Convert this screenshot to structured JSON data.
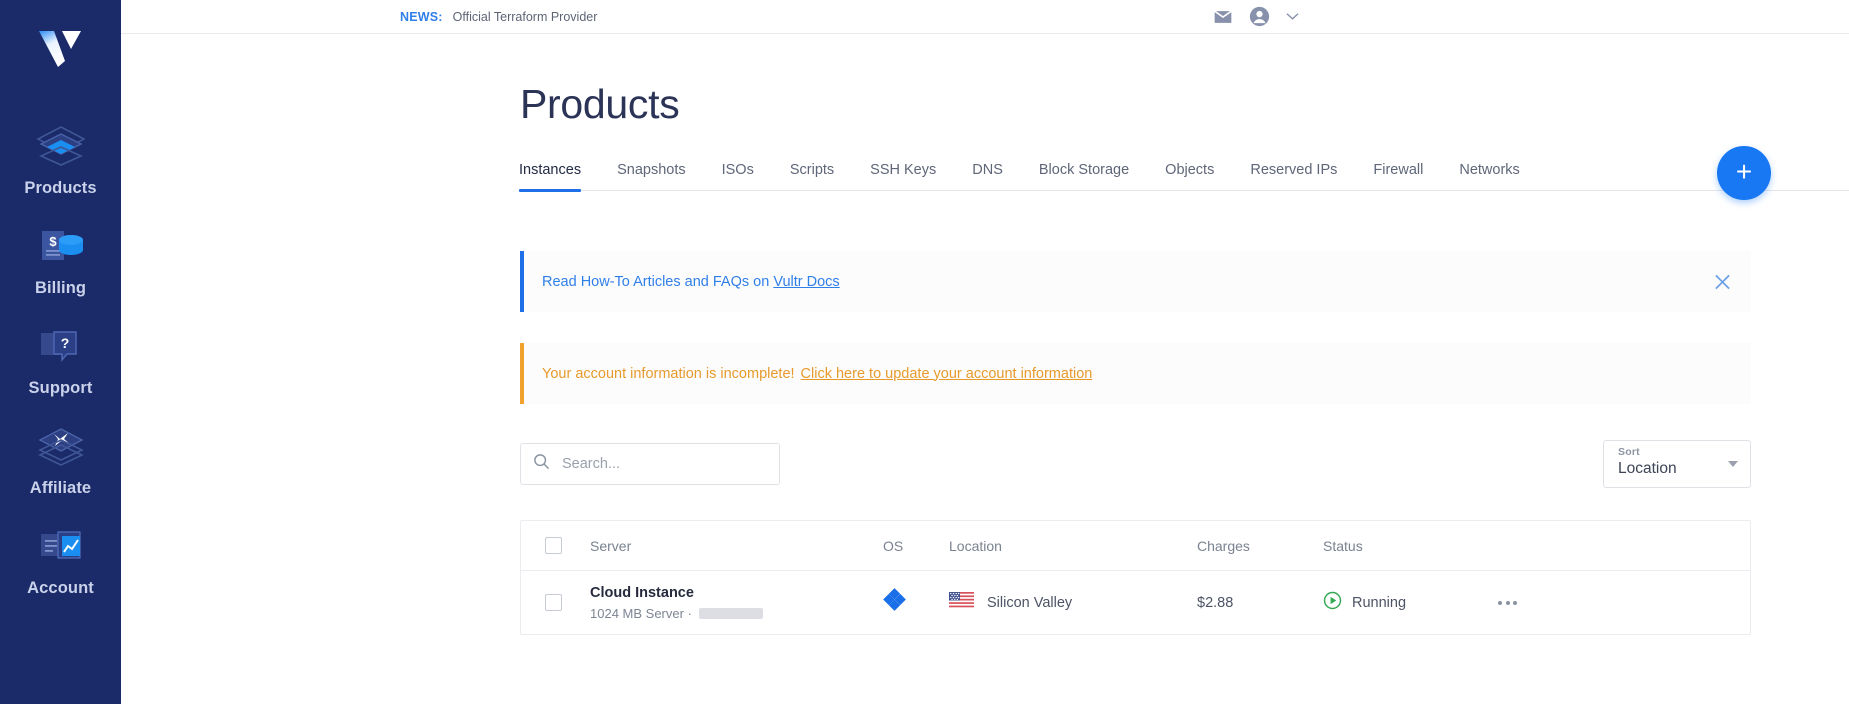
{
  "sidebar": {
    "logo": "vultr-logo",
    "items": [
      {
        "label": "Products",
        "icon": "layers-icon"
      },
      {
        "label": "Billing",
        "icon": "billing-dollar-coins-icon"
      },
      {
        "label": "Support",
        "icon": "support-question-icon"
      },
      {
        "label": "Affiliate",
        "icon": "affiliate-x-layers-icon"
      },
      {
        "label": "Account",
        "icon": "account-chart-icon"
      }
    ]
  },
  "topbar": {
    "news_tag": "NEWS:",
    "news_text": "Official Terraform Provider",
    "mail_icon": "mail-icon",
    "account_icon": "account-circle-icon",
    "chevron_icon": "chevron-down-icon"
  },
  "page": {
    "title": "Products"
  },
  "tabs": [
    {
      "label": "Instances",
      "active": true
    },
    {
      "label": "Snapshots",
      "active": false
    },
    {
      "label": "ISOs",
      "active": false
    },
    {
      "label": "Scripts",
      "active": false
    },
    {
      "label": "SSH Keys",
      "active": false
    },
    {
      "label": "DNS",
      "active": false
    },
    {
      "label": "Block Storage",
      "active": false
    },
    {
      "label": "Objects",
      "active": false
    },
    {
      "label": "Reserved IPs",
      "active": false
    },
    {
      "label": "Firewall",
      "active": false
    },
    {
      "label": "Networks",
      "active": false
    }
  ],
  "fab": {
    "label": "+",
    "icon": "plus-icon",
    "color": "#1877f2"
  },
  "banners": {
    "info": {
      "text": "Read How-To Articles and FAQs on ",
      "link": "Vultr Docs",
      "accent": "#1e6fe8",
      "close_icon": "close-icon"
    },
    "warning": {
      "text": "Your account information is incomplete!",
      "link": "Click here to update your account information",
      "accent": "#f0a12e"
    }
  },
  "toolbar": {
    "search_placeholder": "Search...",
    "search_value": "",
    "search_icon": "search-icon",
    "sort_label": "Sort",
    "sort_value": "Location"
  },
  "table": {
    "columns": [
      "Server",
      "OS",
      "Location",
      "Charges",
      "Status"
    ],
    "rows": [
      {
        "server_name": "Cloud Instance",
        "server_sub": "1024 MB Server ·",
        "server_sub_redacted": true,
        "os_icon": "freebsd-diamond-icon",
        "location_flag": "us-flag-icon",
        "location": "Silicon Valley",
        "charges": "$2.88",
        "status": "Running",
        "status_icon": "play-circle-icon",
        "status_color": "#34a853",
        "actions_icon": "more-horizontal-icon"
      }
    ]
  }
}
